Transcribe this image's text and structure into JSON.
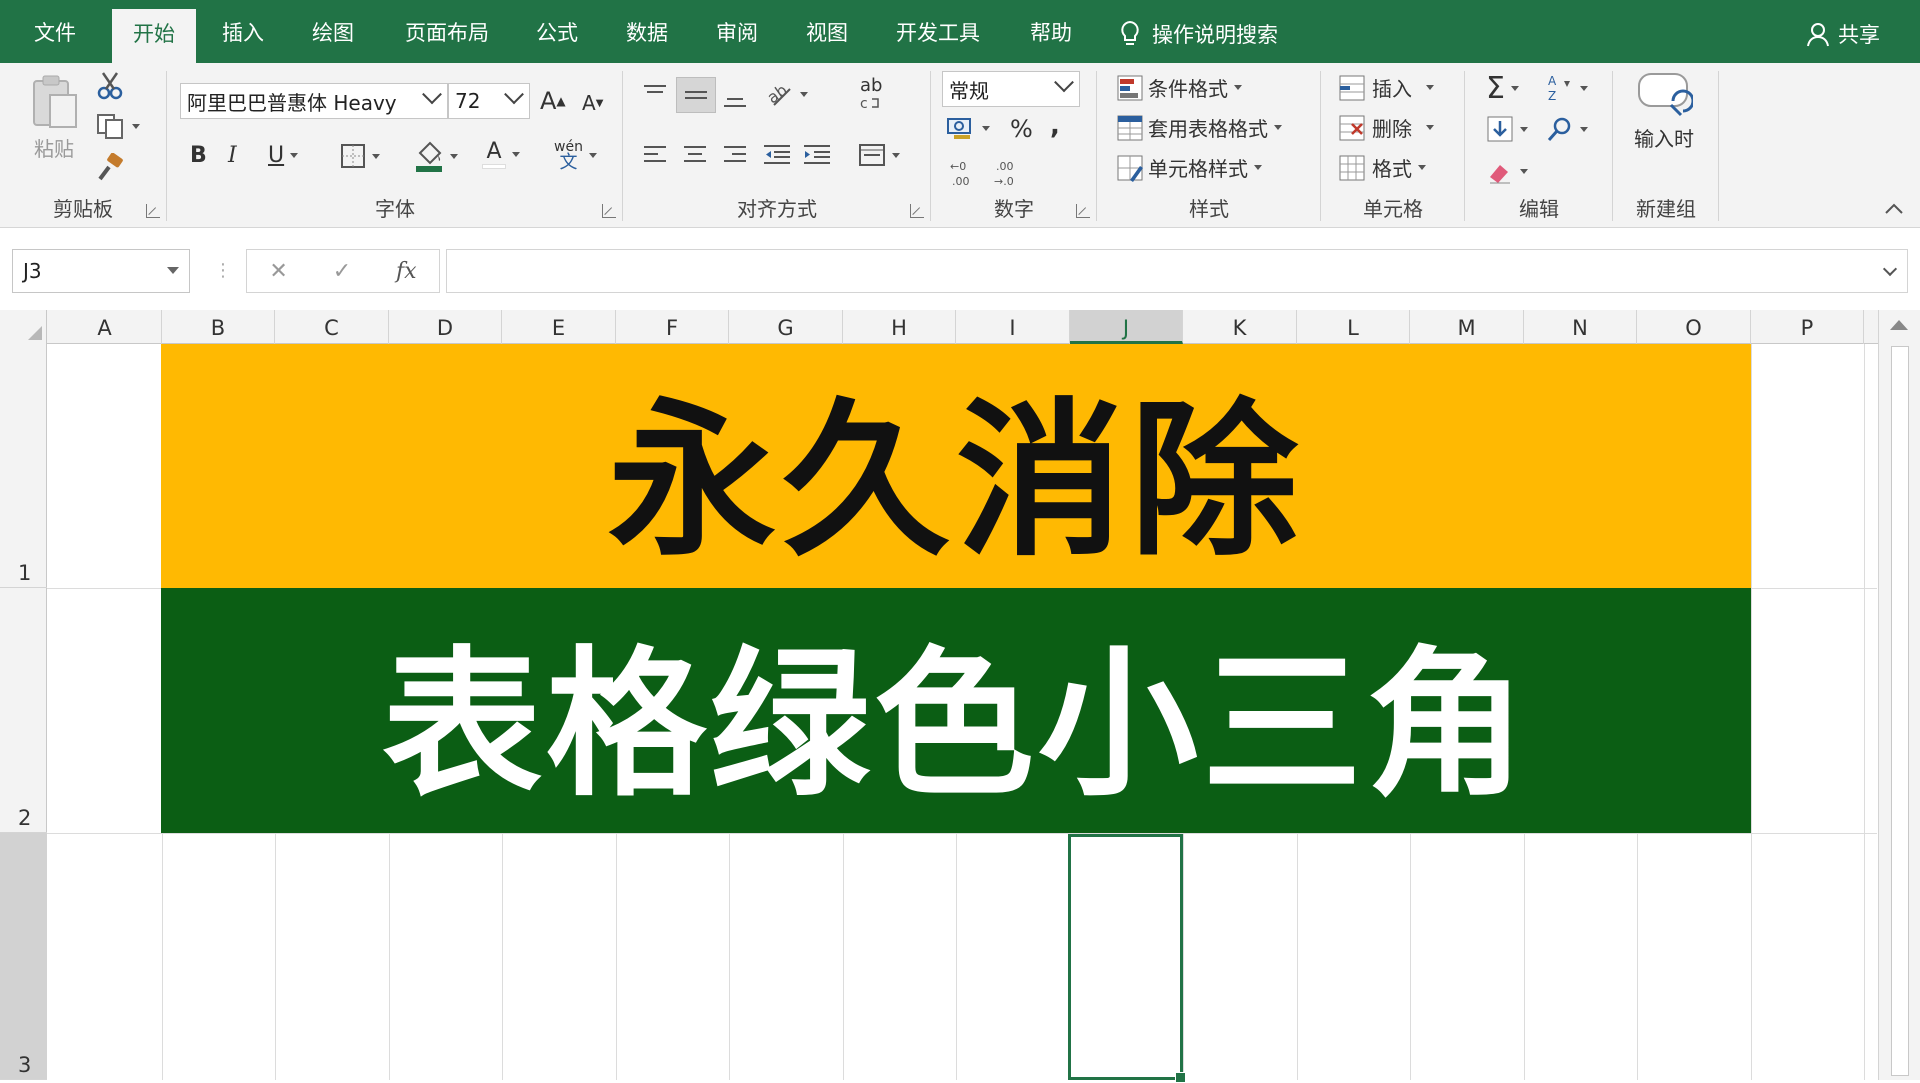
{
  "tabs": [
    {
      "label": "文件",
      "active": false
    },
    {
      "label": "开始",
      "active": true
    },
    {
      "label": "插入",
      "active": false
    },
    {
      "label": "绘图",
      "active": false
    },
    {
      "label": "页面布局",
      "active": false
    },
    {
      "label": "公式",
      "active": false
    },
    {
      "label": "数据",
      "active": false
    },
    {
      "label": "审阅",
      "active": false
    },
    {
      "label": "视图",
      "active": false
    },
    {
      "label": "开发工具",
      "active": false
    },
    {
      "label": "帮助",
      "active": false
    }
  ],
  "tell_me": "操作说明搜索",
  "share": "共享",
  "ribbon": {
    "clipboard": {
      "paste": "粘贴",
      "label": "剪贴板"
    },
    "font": {
      "name": "阿里巴巴普惠体 Heavy",
      "size": "72",
      "grow": "A",
      "shrink": "A",
      "bold": "B",
      "italic": "I",
      "underline": "U",
      "font_color": "A",
      "phonetic": "wén",
      "label": "字体"
    },
    "alignment": {
      "wrap": "ab",
      "label": "对齐方式"
    },
    "number": {
      "format": "常规",
      "percent": "%",
      "comma": ",",
      "label": "数字"
    },
    "styles": {
      "conditional": "条件格式",
      "table": "套用表格格式",
      "cell": "单元格样式",
      "label": "样式"
    },
    "cells": {
      "insert": "插入",
      "delete": "删除",
      "format": "格式",
      "label": "单元格"
    },
    "editing": {
      "label": "编辑"
    },
    "newgroup": {
      "button": "输入时",
      "label": "新建组"
    }
  },
  "formula_bar": {
    "name_box": "J3",
    "fx": "fx",
    "cancel": "✕",
    "confirm": "✓",
    "value": ""
  },
  "columns": [
    "A",
    "B",
    "C",
    "D",
    "E",
    "F",
    "G",
    "H",
    "I",
    "J",
    "K",
    "L",
    "M",
    "N",
    "O",
    "P"
  ],
  "rows": [
    "1",
    "2",
    "3"
  ],
  "selected_cell": "J3",
  "cells": {
    "B1": "永久消除",
    "B2": "表格绿色小三角"
  },
  "colors": {
    "accent": "#217346",
    "banner1_bg": "#ffb902",
    "banner2_bg": "#0b5e14"
  }
}
